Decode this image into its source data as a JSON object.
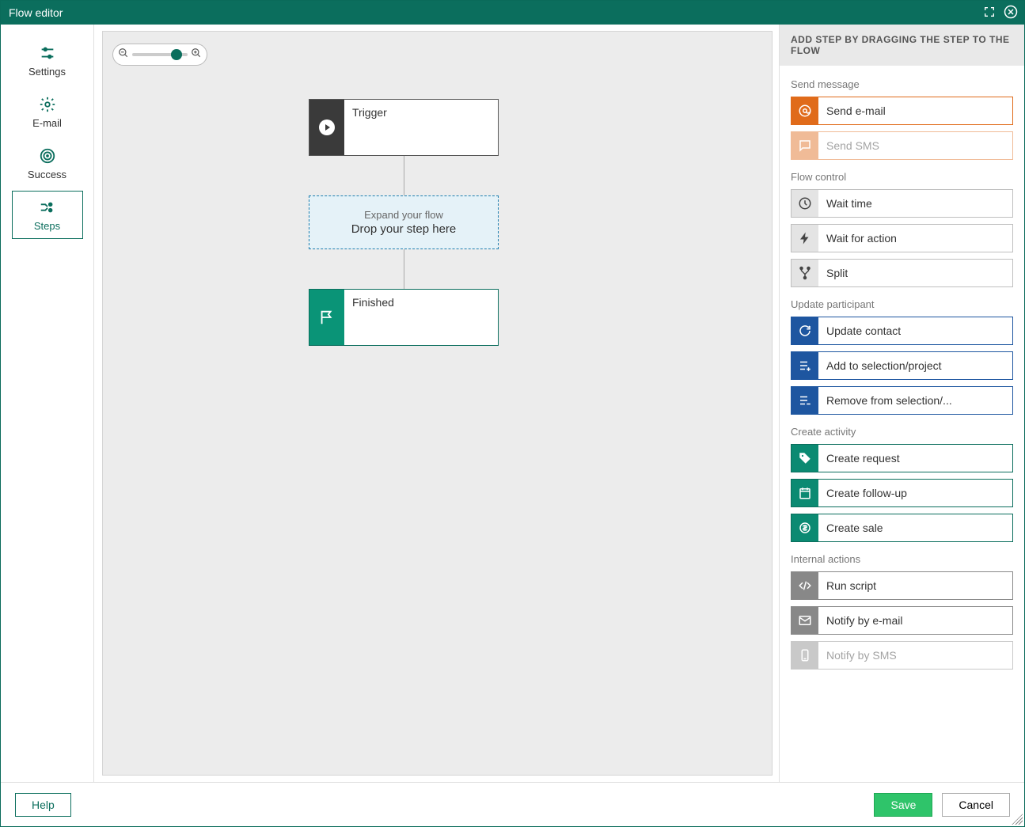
{
  "titlebar": {
    "title": "Flow editor"
  },
  "sidebar": {
    "items": [
      {
        "label": "Settings"
      },
      {
        "label": "E-mail"
      },
      {
        "label": "Success"
      },
      {
        "label": "Steps"
      }
    ]
  },
  "canvas": {
    "trigger_label": "Trigger",
    "dropzone_title": "Expand your flow",
    "dropzone_main": "Drop your step here",
    "finished_label": "Finished"
  },
  "panel": {
    "header": "ADD STEP BY DRAGGING THE STEP TO THE FLOW",
    "groups": {
      "send_message": {
        "label": "Send message",
        "items": [
          {
            "label": "Send e-mail",
            "icon": "at-icon"
          },
          {
            "label": "Send SMS",
            "icon": "chat-icon"
          }
        ]
      },
      "flow_control": {
        "label": "Flow control",
        "items": [
          {
            "label": "Wait time",
            "icon": "clock-icon"
          },
          {
            "label": "Wait for action",
            "icon": "bolt-icon"
          },
          {
            "label": "Split",
            "icon": "split-icon"
          }
        ]
      },
      "update_participant": {
        "label": "Update participant",
        "items": [
          {
            "label": "Update contact",
            "icon": "refresh-icon"
          },
          {
            "label": "Add to selection/project",
            "icon": "list-add-icon"
          },
          {
            "label": "Remove from selection/...",
            "icon": "list-remove-icon"
          }
        ]
      },
      "create_activity": {
        "label": "Create activity",
        "items": [
          {
            "label": "Create request",
            "icon": "tag-icon"
          },
          {
            "label": "Create follow-up",
            "icon": "calendar-icon"
          },
          {
            "label": "Create sale",
            "icon": "sale-icon"
          }
        ]
      },
      "internal_actions": {
        "label": "Internal actions",
        "items": [
          {
            "label": "Run script",
            "icon": "code-icon"
          },
          {
            "label": "Notify by e-mail",
            "icon": "mail-icon"
          },
          {
            "label": "Notify by SMS",
            "icon": "sms-icon"
          }
        ]
      }
    }
  },
  "footer": {
    "help": "Help",
    "save": "Save",
    "cancel": "Cancel"
  }
}
